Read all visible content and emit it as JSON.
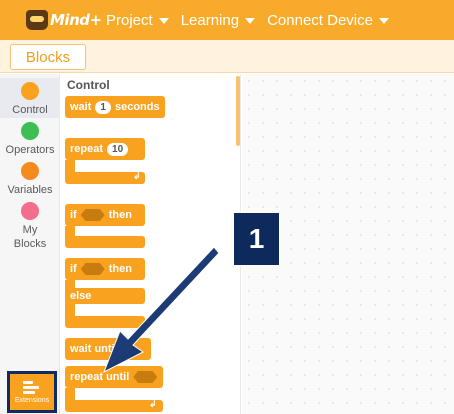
{
  "app": {
    "logo_text": "Mind+"
  },
  "menu": {
    "items": [
      {
        "label": "Project"
      },
      {
        "label": "Learning"
      },
      {
        "label": "Connect Device"
      }
    ]
  },
  "tabs": {
    "blocks_label": "Blocks"
  },
  "categories": [
    {
      "label": "Control",
      "color": "#f8a21f",
      "selected": true
    },
    {
      "label": "Operators",
      "color": "#3ebf55"
    },
    {
      "label": "Variables",
      "color": "#f58a1f"
    },
    {
      "label": "My Blocks",
      "color": "#f36d8c"
    }
  ],
  "extensions": {
    "label": "Extensions"
  },
  "palette": {
    "title": "Control",
    "blocks": {
      "wait": {
        "prefix": "wait",
        "value": "1",
        "suffix": "seconds"
      },
      "repeat": {
        "prefix": "repeat",
        "value": "10"
      },
      "if_then": {
        "if": "if",
        "then": "then"
      },
      "if_else": {
        "if": "if",
        "then": "then",
        "else": "else"
      },
      "wait_until": {
        "label": "wait until"
      },
      "repeat_until": {
        "label": "repeat until"
      }
    }
  },
  "annotation": {
    "step": "1",
    "color": "#0e2a5c"
  }
}
